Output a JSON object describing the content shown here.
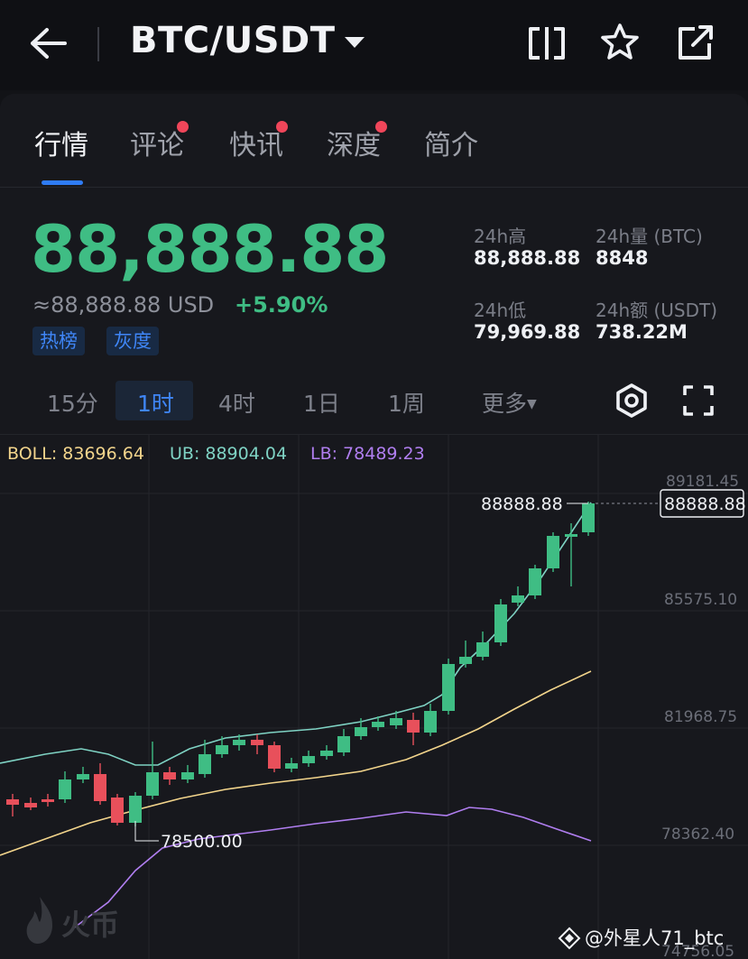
{
  "header": {
    "pair": "BTC/USDT",
    "icons": [
      "back-arrow-icon",
      "caret-down-icon",
      "split-screen-icon",
      "star-icon",
      "share-icon"
    ]
  },
  "tabs": [
    {
      "label": "行情",
      "active": true,
      "dot": false
    },
    {
      "label": "评论",
      "active": false,
      "dot": true
    },
    {
      "label": "快讯",
      "active": false,
      "dot": true
    },
    {
      "label": "深度",
      "active": false,
      "dot": true
    },
    {
      "label": "简介",
      "active": false,
      "dot": false
    }
  ],
  "ticker": {
    "last_price": "88,888.88",
    "usd_price": "≈88,888.88 USD",
    "change": "+5.90%",
    "badges": [
      "热榜",
      "灰度"
    ],
    "stats": {
      "high_label": "24h高",
      "high_value": "88,888.88",
      "low_label": "24h低",
      "low_value": "79,969.88",
      "vol_label": "24h量 (BTC)",
      "vol_value": "8848",
      "amount_label": "24h额 (USDT)",
      "amount_value": "738.22M"
    }
  },
  "intervals": {
    "items": [
      "15分",
      "1时",
      "4时",
      "1日",
      "1周"
    ],
    "active": "1时",
    "more": "更多"
  },
  "indicators": {
    "boll": "BOLL: 83696.64",
    "ub": "UB: 88904.04",
    "lb": "LB: 78489.23"
  },
  "chart_data": {
    "type": "candlestick",
    "y_ticks": [
      "89181.45",
      "85575.10",
      "81968.75",
      "78362.40",
      "74756.05"
    ],
    "last_price_label": "88888.88",
    "max_marker": "88888.88",
    "min_marker": "78500.00",
    "colors": {
      "up": "#3fbd84",
      "down": "#e8505b",
      "boll": "#f3d58c",
      "ub": "#7fd3c4",
      "lb": "#b07ef0"
    }
  },
  "watermark": {
    "logo_text": "火币",
    "user": "@外星人71_btc"
  }
}
